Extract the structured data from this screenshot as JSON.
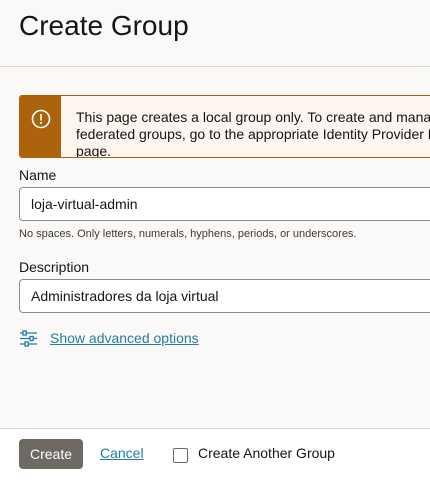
{
  "header": {
    "title": "Create Group"
  },
  "notice": {
    "icon": "warning-icon",
    "text": "This page creates a local group only. To create and manage federated groups, go to the appropriate Identity Provider Details page.",
    "color": "#ac630c"
  },
  "form": {
    "name": {
      "label": "Name",
      "value": "loja-virtual-admin",
      "help": "No spaces. Only letters, numerals, hyphens, periods, or underscores."
    },
    "description": {
      "label": "Description",
      "value": "Administradores da loja virtual"
    },
    "advanced": {
      "icon": "sliders-icon",
      "label": "Show advanced options"
    }
  },
  "footer": {
    "create_label": "Create",
    "cancel_label": "Cancel",
    "create_another_label": "Create Another Group",
    "create_another_checked": false
  },
  "colors": {
    "link": "#227e9e",
    "primary_button": "#6f6964",
    "warning": "#ac630c"
  }
}
